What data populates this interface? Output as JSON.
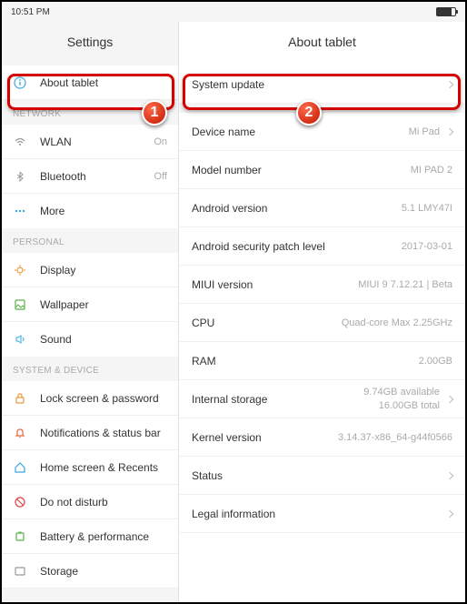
{
  "statusbar": {
    "time": "10:51 PM"
  },
  "left": {
    "title": "Settings",
    "about_tablet": "About tablet",
    "sections": {
      "network": "NETWORK",
      "personal": "PERSONAL",
      "system": "SYSTEM & DEVICE"
    },
    "items": {
      "wlan": {
        "label": "WLAN",
        "value": "On"
      },
      "bluetooth": {
        "label": "Bluetooth",
        "value": "Off"
      },
      "more": {
        "label": "More"
      },
      "display": {
        "label": "Display"
      },
      "wallpaper": {
        "label": "Wallpaper"
      },
      "sound": {
        "label": "Sound"
      },
      "lock": {
        "label": "Lock screen & password"
      },
      "notif": {
        "label": "Notifications & status bar"
      },
      "home": {
        "label": "Home screen & Recents"
      },
      "dnd": {
        "label": "Do not disturb"
      },
      "battery": {
        "label": "Battery & performance"
      },
      "storage": {
        "label": "Storage"
      }
    }
  },
  "right": {
    "title": "About tablet",
    "items": {
      "update": {
        "label": "System update"
      },
      "device_name": {
        "label": "Device name",
        "value": "Mi Pad"
      },
      "model": {
        "label": "Model number",
        "value": "MI PAD 2"
      },
      "android": {
        "label": "Android version",
        "value": "5.1 LMY47I"
      },
      "patch": {
        "label": "Android security patch level",
        "value": "2017-03-01"
      },
      "miui": {
        "label": "MIUI version",
        "value": "MIUI 9 7.12.21 | Beta"
      },
      "cpu": {
        "label": "CPU",
        "value": "Quad-core Max 2.25GHz"
      },
      "ram": {
        "label": "RAM",
        "value": "2.00GB"
      },
      "storage": {
        "label": "Internal storage",
        "value_line1": "9.74GB available",
        "value_line2": "16.00GB total"
      },
      "kernel": {
        "label": "Kernel version",
        "value": "3.14.37-x86_64-g44f0566"
      },
      "status": {
        "label": "Status"
      },
      "legal": {
        "label": "Legal information"
      }
    }
  },
  "annotations": {
    "badge1": "1",
    "badge2": "2"
  }
}
